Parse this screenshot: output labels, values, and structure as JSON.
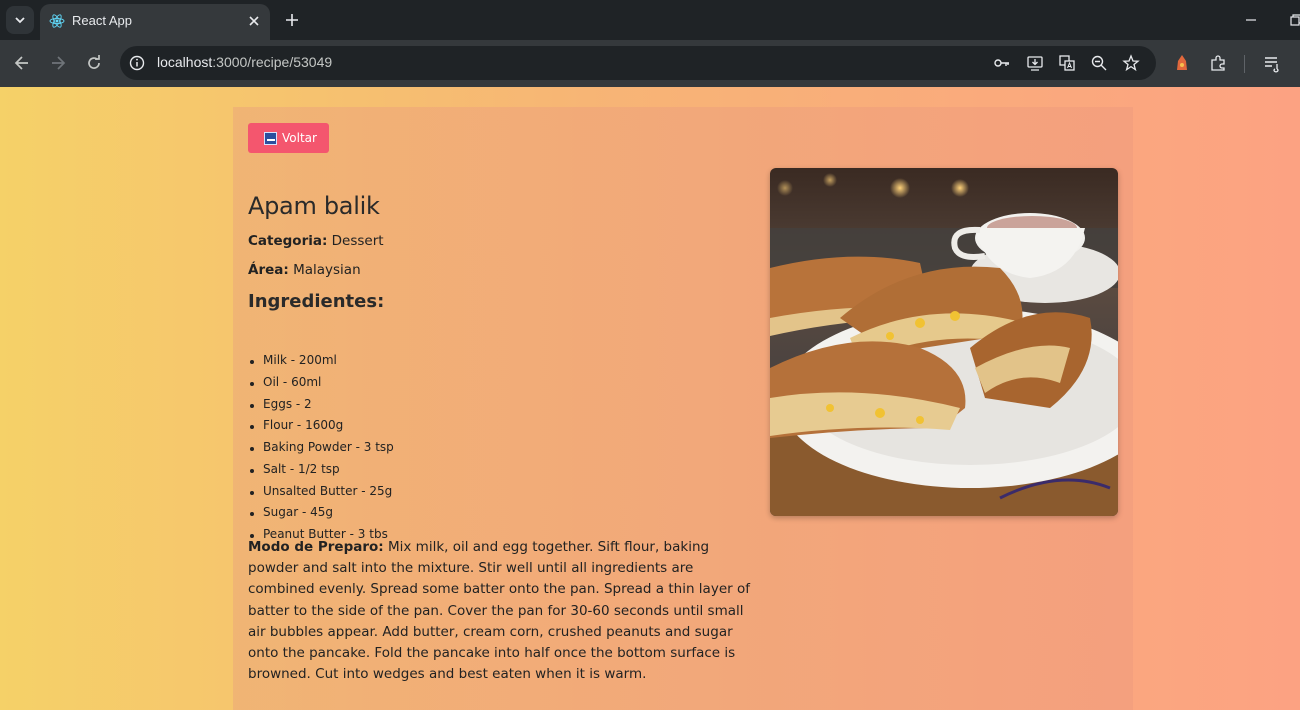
{
  "browser": {
    "tab_title": "React App",
    "url_host": "localhost",
    "url_path": ":3000/recipe/53049"
  },
  "page": {
    "back_label": "Voltar",
    "recipe_title": "Apam balik",
    "category_label": "Categoria:",
    "category_value": "Dessert",
    "area_label": "Área:",
    "area_value": "Malaysian",
    "ingredients_heading": "Ingredientes:",
    "ingredients": [
      "Milk - 200ml",
      "Oil - 60ml",
      "Eggs - 2",
      "Flour - 1600g",
      "Baking Powder - 3 tsp",
      "Salt - 1/2 tsp",
      "Unsalted Butter - 25g",
      "Sugar - 45g",
      "Peanut Butter - 3 tbs"
    ],
    "instructions_label": "Modo de Preparo:",
    "instructions_text": "Mix milk, oil and egg together. Sift flour, baking powder and salt into the mixture. Stir well until all ingredients are combined evenly. Spread some batter onto the pan. Spread a thin layer of batter to the side of the pan. Cover the pan for 30-60 seconds until small air bubbles appear. Add butter, cream corn, crushed peanuts and sugar onto the pancake. Fold the pancake into half once the bottom surface is browned. Cut into wedges and best eaten when it is warm."
  },
  "colors": {
    "back_button": "#f4566e",
    "gradient_start": "#f5d168",
    "gradient_end": "#fca282"
  }
}
